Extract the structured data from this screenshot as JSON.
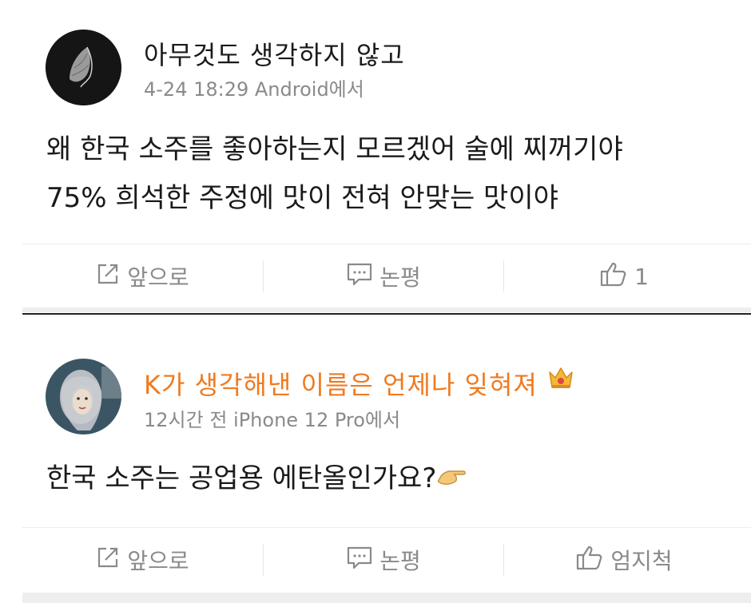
{
  "posts": [
    {
      "username": "아무것도 생각하지 않고",
      "meta": "4-24 18:29 Android에서",
      "content_lines": [
        "왜 한국 소주를 좋아하는지 모르겠어 술에 찌꺼기야",
        "75% 희석한 주정에 맛이 전혀 안맞는 맛이야"
      ],
      "actions": {
        "forward_label": "앞으로",
        "comment_label": "논평",
        "like_label": "1"
      }
    },
    {
      "username": "K가 생각해낸 이름은 언제나 잊혀져",
      "username_color": "#f07a1f",
      "meta": "12시간 전 iPhone 12 Pro에서",
      "content_lines": [
        "한국 소주는 공업용 에탄올인가요?"
      ],
      "actions": {
        "forward_label": "앞으로",
        "comment_label": "논평",
        "like_label": "엄지척"
      }
    }
  ],
  "icons": {
    "forward": "share-arrow-icon",
    "comment": "comment-bubble-icon",
    "like": "thumbs-up-icon",
    "badge": "crown-icon",
    "emoji": "pointing-hand-emoji"
  }
}
